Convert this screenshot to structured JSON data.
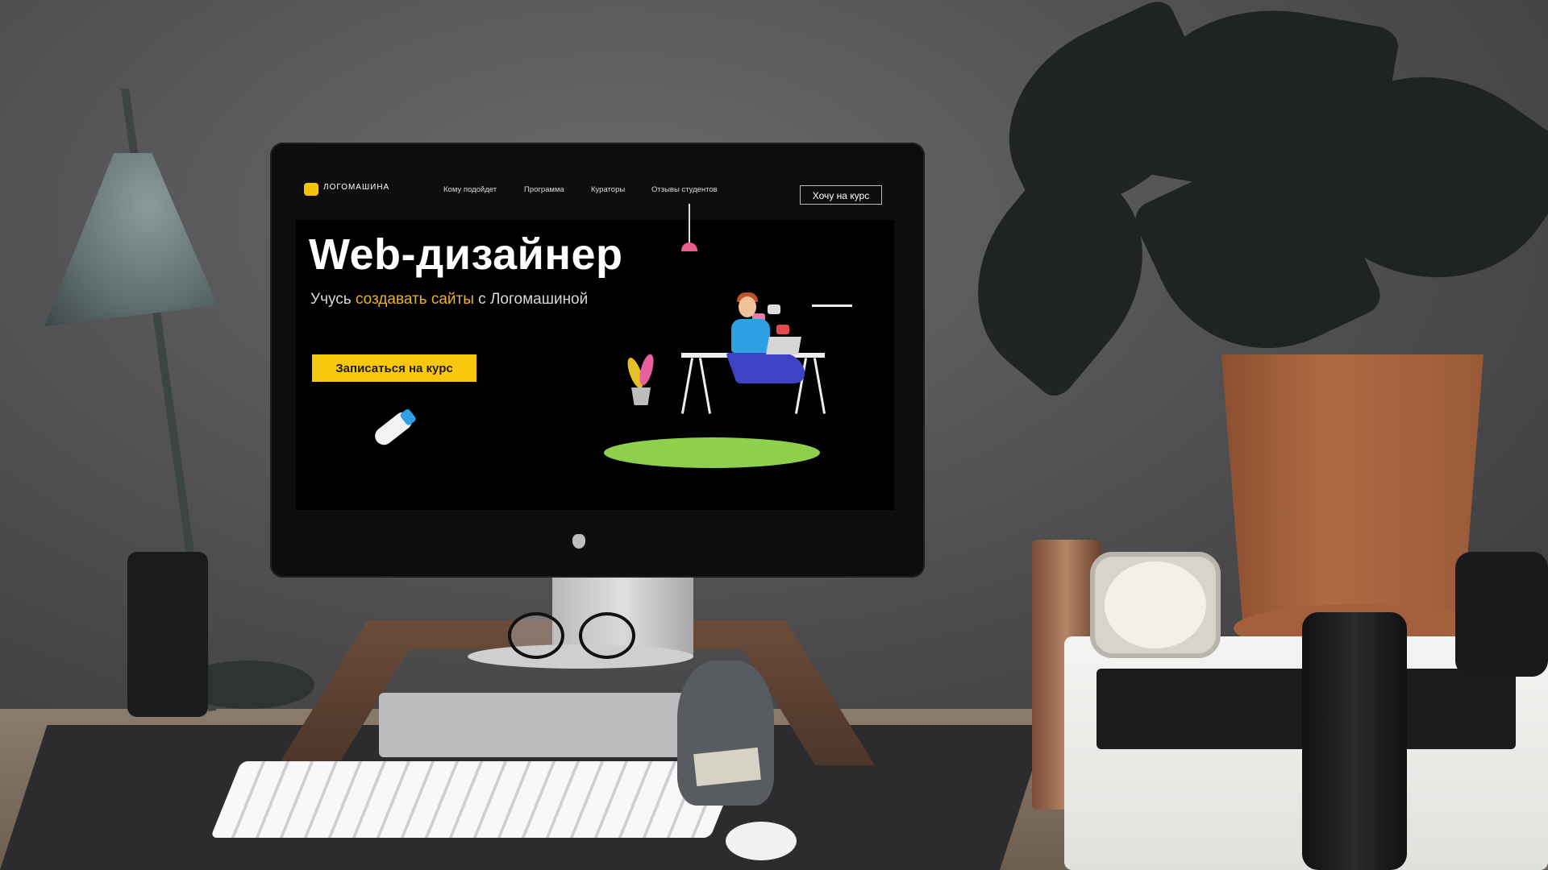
{
  "site": {
    "logo_text": "ЛОГОМАШИНА",
    "nav": [
      {
        "label": "Кому подойдет"
      },
      {
        "label": "Программа"
      },
      {
        "label": "Кураторы"
      },
      {
        "label": "Отзывы студентов"
      }
    ],
    "cta_top": "Хочу на курс",
    "hero": {
      "title": "Web-дизайнер",
      "subtitle_before": "Учусь ",
      "subtitle_accent": "создавать сайты",
      "subtitle_after": " с Логомашиной",
      "signup_button": "Записаться на курс"
    },
    "colors": {
      "accent_yellow": "#f9c70b",
      "accent_orange": "#f0b12a",
      "grass_green": "#8ed04b",
      "background": "#000000"
    }
  },
  "scene": {
    "icons": [
      "apple-logo-icon",
      "smiley-logo-icon"
    ]
  }
}
